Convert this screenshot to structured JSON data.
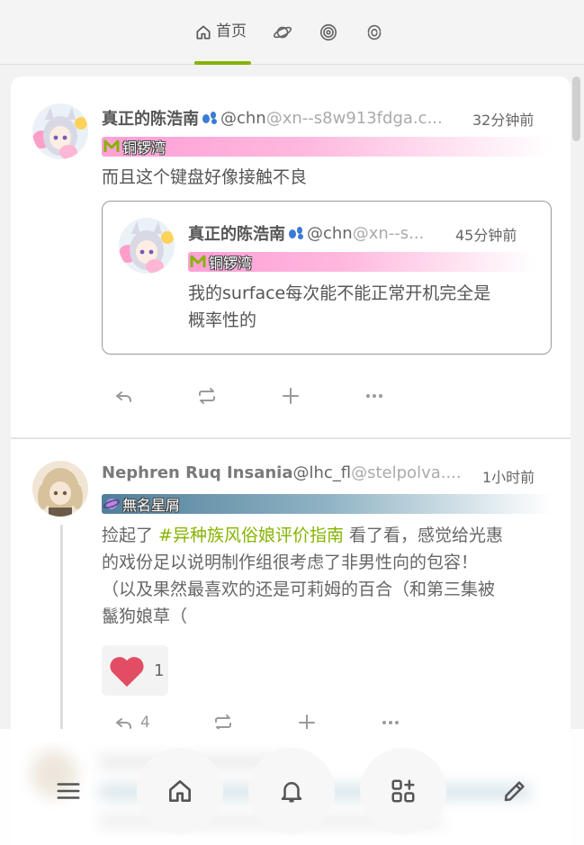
{
  "header": {
    "tabs": [
      {
        "label": "首页",
        "icon": "home-icon",
        "active": true
      },
      {
        "label": "",
        "icon": "planet-icon"
      },
      {
        "label": "",
        "icon": "spiral-icon"
      },
      {
        "label": "",
        "icon": "swirl-icon"
      }
    ],
    "accent_color": "#86b300"
  },
  "posts": [
    {
      "name": "真正的陈浩南",
      "username": "@chn",
      "host": "@xn--s8w913fdga.c...",
      "time": "32分钟前",
      "instance": "铜锣湾",
      "text": "而且这个键盘好像接触不良",
      "quote": {
        "name": "真正的陈浩南",
        "username": "@chn",
        "host": "@xn--s...",
        "time": "45分钟前",
        "instance": "铜锣湾",
        "text_line1": "我的surface每次能不能正常开机完全是",
        "text_line2": "概率性的"
      },
      "actions": [
        "reply-icon",
        "renote-icon",
        "plus-icon",
        "more-icon"
      ]
    },
    {
      "name": "Nephren Ruq Insania",
      "username": "@lhc_fl",
      "host": "@stelpolva....",
      "time": "1小时前",
      "instance": "無名星屑",
      "text_before": "捡起了 ",
      "hashtag": "#异种族风俗娘评价指南",
      "text_line1_after": " 看了看，感觉给光惠",
      "text_line2": "的戏份足以说明制作组很考虑了非男性向的包容！",
      "text_line3": "（以及果然最喜欢的还是可莉姆的百合（和第三集被",
      "text_line4": "鬣狗娘草（",
      "reaction": {
        "emoji": "heart-icon",
        "count": "1"
      },
      "reply_count": "4"
    }
  ],
  "bottom_nav": [
    "menu-icon",
    "home-icon",
    "bell-icon",
    "widgets-icon",
    "pencil-icon"
  ]
}
